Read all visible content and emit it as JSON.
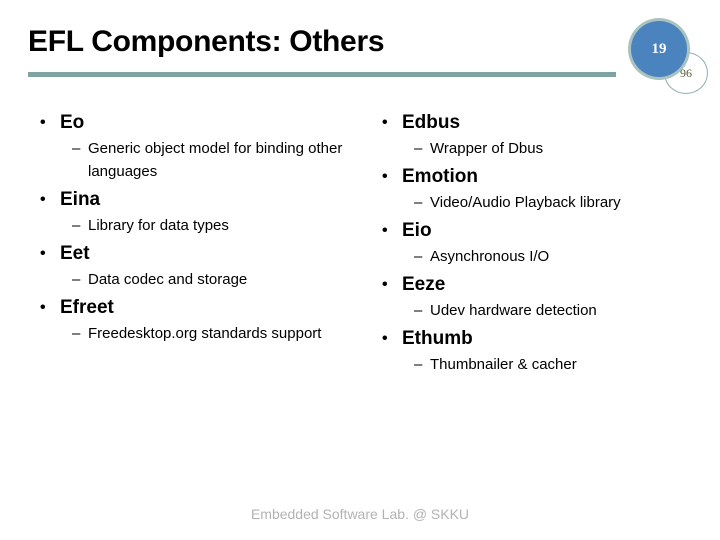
{
  "slide": {
    "title": "EFL Components: Others",
    "footer": "Embedded Software Lab. @ SKKU",
    "accent_color": "#7fa3a0",
    "badge_color": "#4a83bd",
    "footer_color": "#b3b3b3"
  },
  "badge": {
    "page_number": "19",
    "total_pages": "96"
  },
  "bullet_glyph": "•",
  "dash_glyph": "–",
  "columns": {
    "left": [
      {
        "label": "Eo",
        "detail": "Generic object model for binding other languages"
      },
      {
        "label": "Eina",
        "detail": "Library for data types"
      },
      {
        "label": "Eet",
        "detail": "Data codec and storage"
      },
      {
        "label": "Efreet",
        "detail": "Freedesktop.org standards support"
      }
    ],
    "right": [
      {
        "label": "Edbus",
        "detail": "Wrapper of Dbus"
      },
      {
        "label": "Emotion",
        "detail": "Video/Audio Playback library"
      },
      {
        "label": "Eio",
        "detail": "Asynchronous I/O"
      },
      {
        "label": "Eeze",
        "detail": "Udev hardware detection"
      },
      {
        "label": "Ethumb",
        "detail": "Thumbnailer & cacher"
      }
    ]
  }
}
